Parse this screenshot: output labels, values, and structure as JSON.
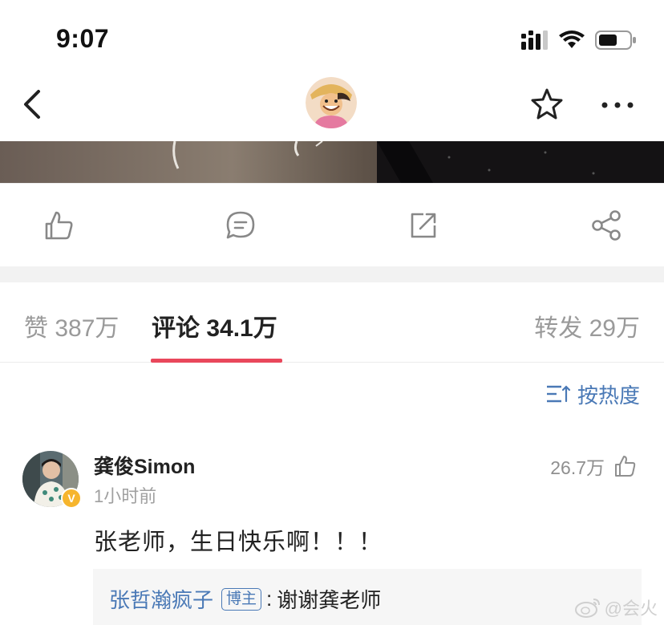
{
  "status_bar": {
    "time": "9:07",
    "icons": [
      "cellular-signal-icon",
      "wifi-icon",
      "battery-icon"
    ]
  },
  "nav": {
    "icons": [
      "back-arrow-icon",
      "profile-avatar",
      "star-icon",
      "more-dots-icon"
    ]
  },
  "action_bar": {
    "icons": [
      "thumbs-up-icon",
      "comment-bubble-icon",
      "repost-icon",
      "share-icon"
    ]
  },
  "tabs": {
    "likes": "赞 387万",
    "comments": "评论 34.1万",
    "reposts": "转发 29万",
    "active": "comments"
  },
  "sort": {
    "label": "按热度",
    "icon": "sort-lines-icon"
  },
  "comment": {
    "author": "龚俊Simon",
    "time": "1小时前",
    "likes": "26.7万",
    "text": "张老师，生日快乐啊！！！",
    "reply": {
      "user": "张哲瀚疯子",
      "tag": "博主",
      "separator": ":",
      "text": "谢谢龚老师"
    }
  },
  "watermark": {
    "text": "@会火"
  },
  "colors": {
    "accent_blue": "#4a79b6",
    "tab_indicator": "#e9475b",
    "verified_badge": "#f6b52d"
  }
}
